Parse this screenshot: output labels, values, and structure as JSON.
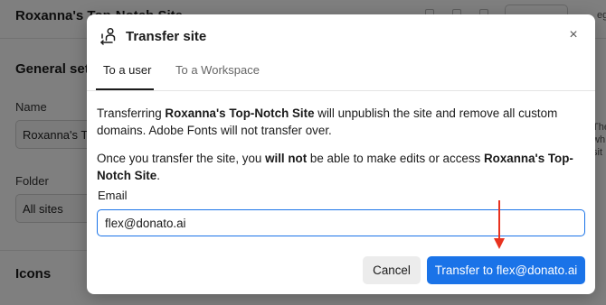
{
  "background": {
    "site_title": "Roxanna's Top-Notch Site",
    "section_general": "General set",
    "name_label": "Name",
    "name_value": "Roxanna's Top-Notch Site",
    "folder_label": "Folder",
    "folder_value": "All sites",
    "section_icons": "Icons",
    "right_fragments": [
      "The",
      "wh",
      "sit"
    ],
    "top_right_fragment": "eg"
  },
  "modal": {
    "title": "Transfer site",
    "close_icon": "×",
    "tabs": [
      {
        "label": "To a user",
        "active": true
      },
      {
        "label": "To a Workspace",
        "active": false
      }
    ],
    "paragraph1": {
      "pre": "Transferring ",
      "site": "Roxanna's Top-Notch Site",
      "post": " will unpublish the site and remove all custom domains. Adobe Fonts will not transfer over."
    },
    "paragraph2": {
      "pre": "Once you transfer the site, you ",
      "emph": "will not",
      "mid": " be able to make edits or access ",
      "site": "Roxanna's Top-Notch Site",
      "post": "."
    },
    "email_label": "Email",
    "email_value": "flex@donato.ai",
    "cancel_label": "Cancel",
    "confirm_label": "Transfer to flex@donato.ai"
  },
  "colors": {
    "accent": "#1a73e8",
    "annotation_arrow": "#e8321f"
  },
  "icons": {
    "transfer": "transfer-person-icon",
    "close": "close-icon",
    "annotation": "red-arrow-down-icon"
  }
}
